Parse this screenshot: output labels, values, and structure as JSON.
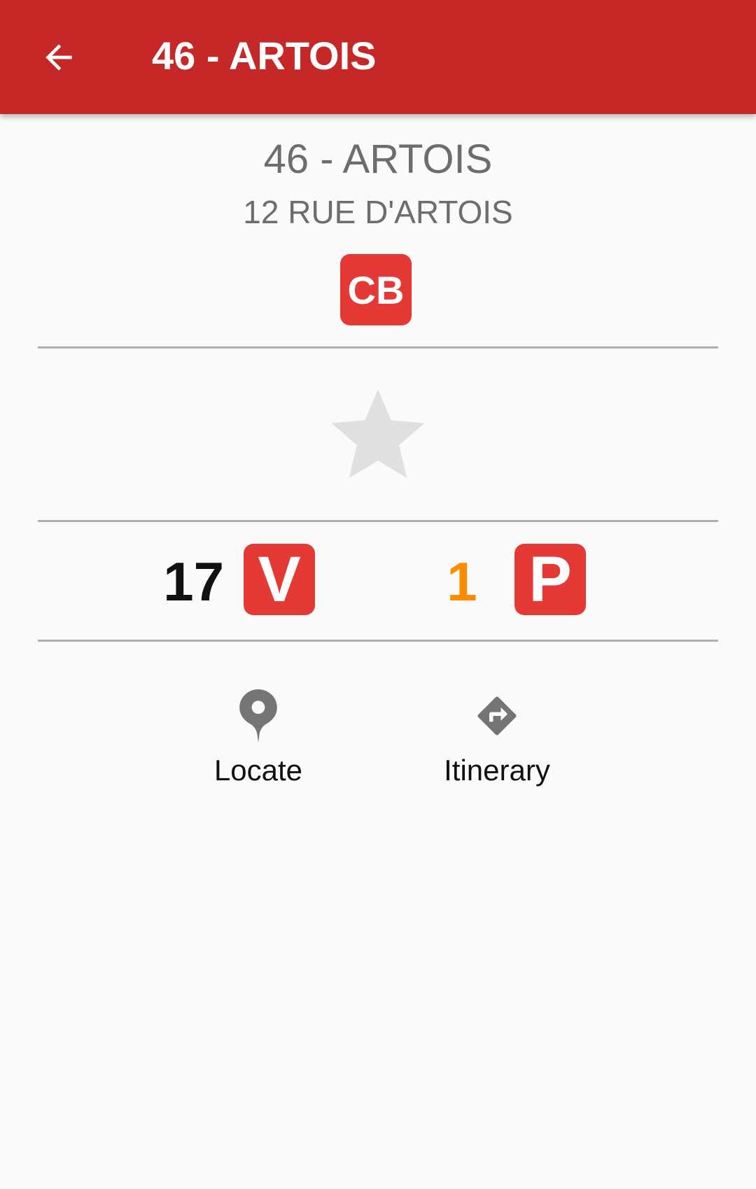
{
  "header": {
    "back_icon": "arrow-back-icon",
    "title": "46 - ARTOIS"
  },
  "station": {
    "name": "46 - ARTOIS",
    "address": "12 RUE D'ARTOIS",
    "payment_badge": "CB"
  },
  "favorite": {
    "icon": "star-icon",
    "active": false,
    "color": "#e0e0e0"
  },
  "availability": {
    "bikes_count": "17",
    "bikes_badge": "V",
    "stands_count": "1",
    "stands_badge": "P",
    "stands_color": "#fb8c00"
  },
  "actions": {
    "locate": {
      "label": "Locate",
      "icon": "map-pin-icon"
    },
    "itinerary": {
      "label": "Itinerary",
      "icon": "directions-icon"
    }
  },
  "colors": {
    "app_bar": "#c62828",
    "badge": "#e53935",
    "background": "#fafafa",
    "secondary_text": "#6d6d6d"
  }
}
